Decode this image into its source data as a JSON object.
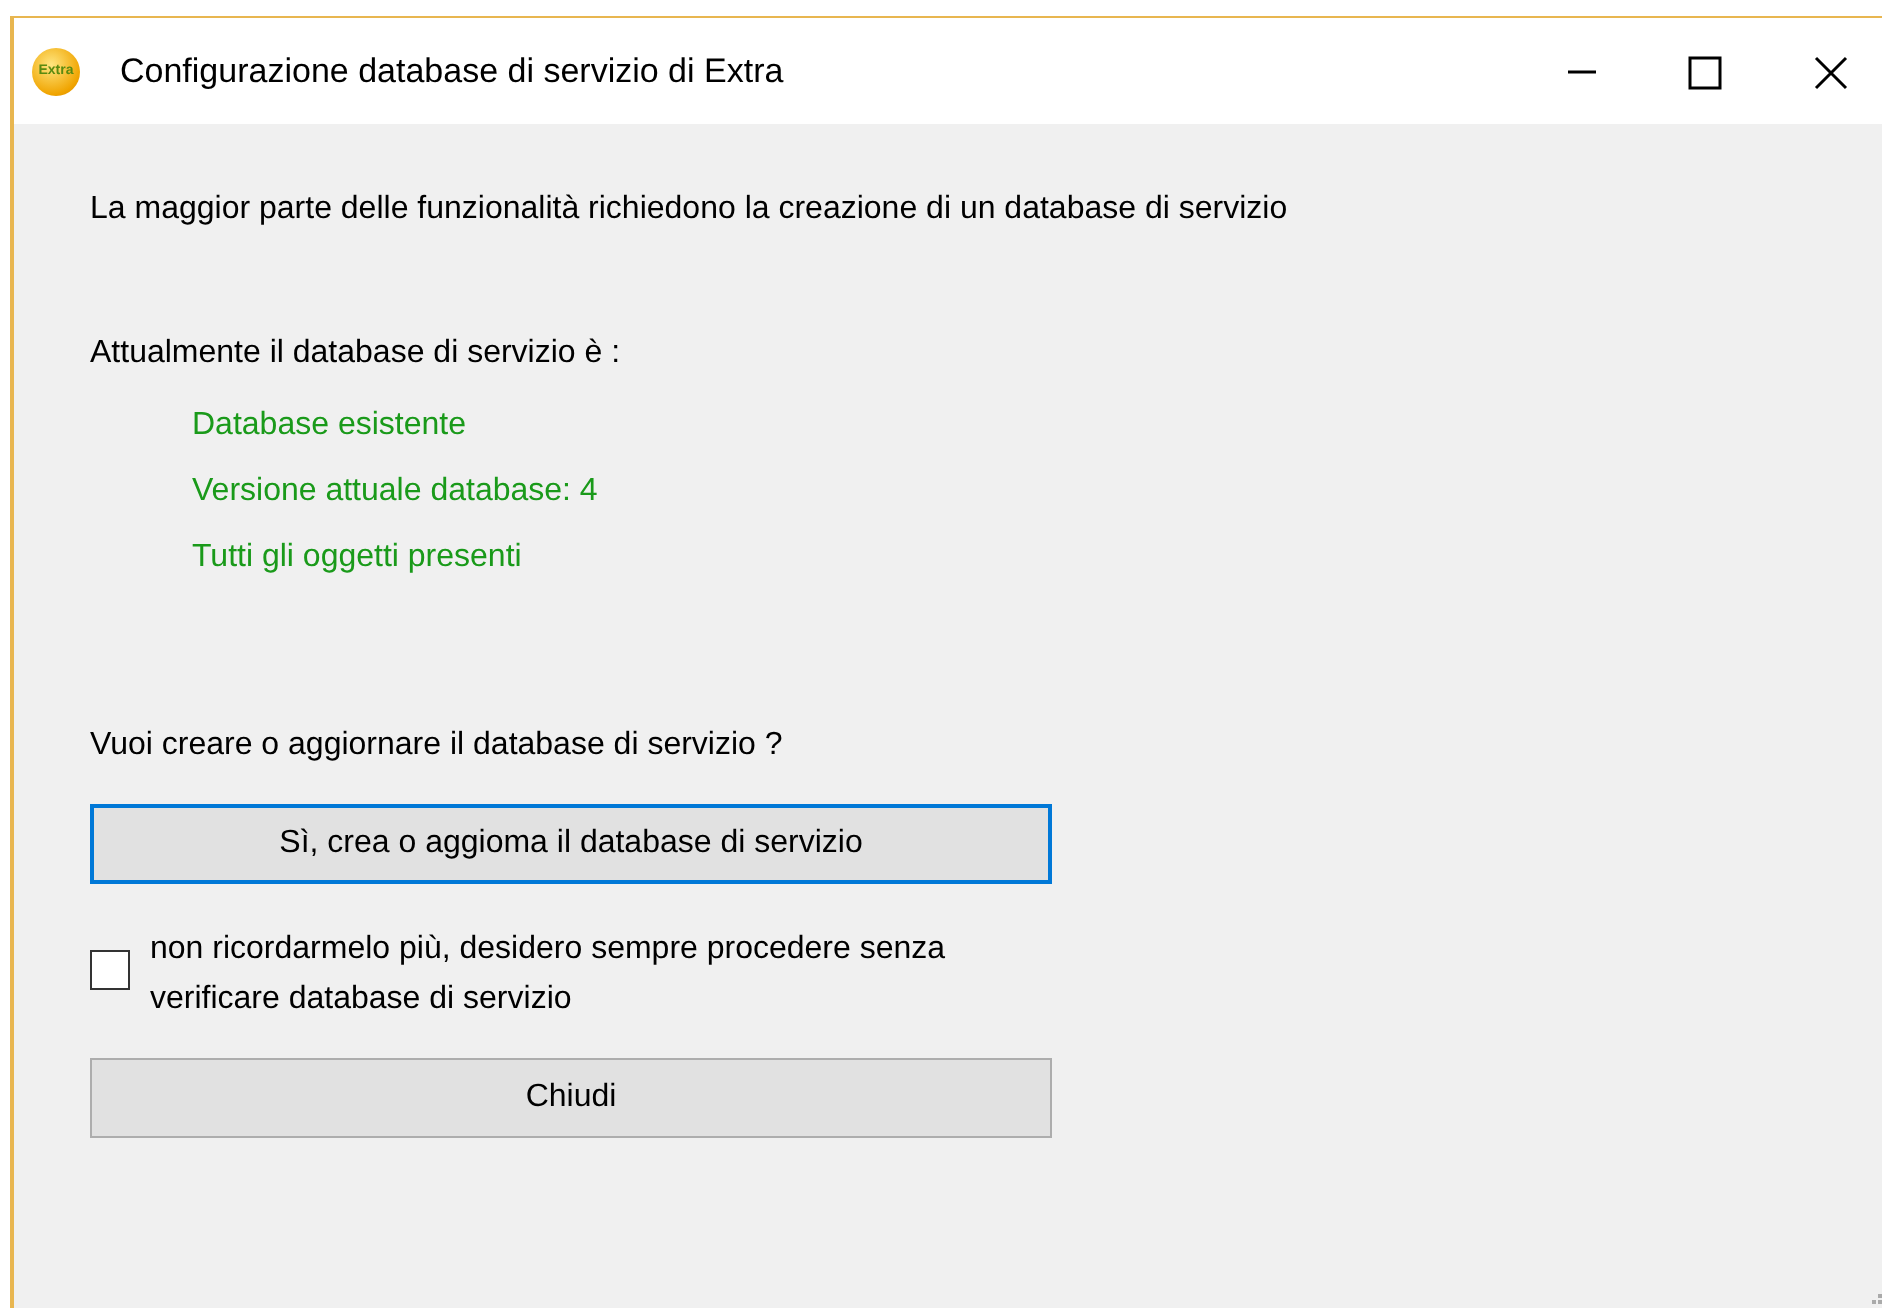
{
  "window": {
    "title": "Configurazione database di servizio di Extra",
    "icon_text": "Extra"
  },
  "intro": "La maggior parte delle funzionalità richiedono la creazione di un database di servizio",
  "status_label": "Attualmente il database di servizio è :",
  "status_lines": [
    "Database esistente",
    "Versione attuale database: 4",
    "Tutti gli oggetti presenti"
  ],
  "question": "Vuoi creare o aggiornare il database di servizio ?",
  "create_button": {
    "label": "Sì, crea o aggioma il database di servizio",
    "focused": true
  },
  "checkbox": {
    "label": "non ricordarmelo più, desidero sempre procedere senza verificare database di servizio",
    "checked": false
  },
  "close_button": {
    "label": "Chiudi",
    "focused": false
  }
}
